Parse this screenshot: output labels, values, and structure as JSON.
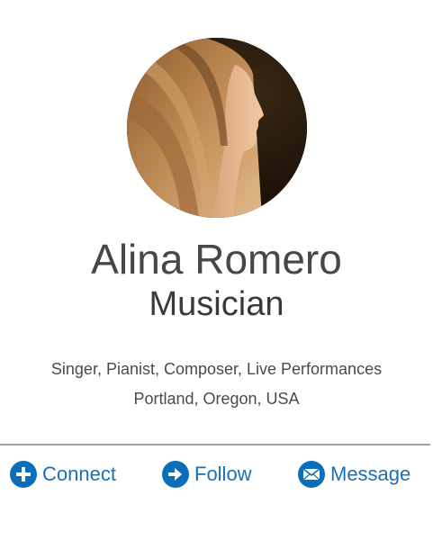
{
  "profile": {
    "name": "Alina Romero",
    "title": "Musician",
    "skills": "Singer, Pianist, Composer, Live Performances",
    "location": "Portland, Oregon, USA"
  },
  "actions": {
    "connect": {
      "label": "Connect",
      "icon": "plus-icon"
    },
    "follow": {
      "label": "Follow",
      "icon": "arrow-right-icon"
    },
    "message": {
      "label": "Message",
      "icon": "envelope-icon"
    }
  },
  "colors": {
    "accent": "#0a6fb8",
    "text": "#474747",
    "divider": "#a0a0a0"
  }
}
